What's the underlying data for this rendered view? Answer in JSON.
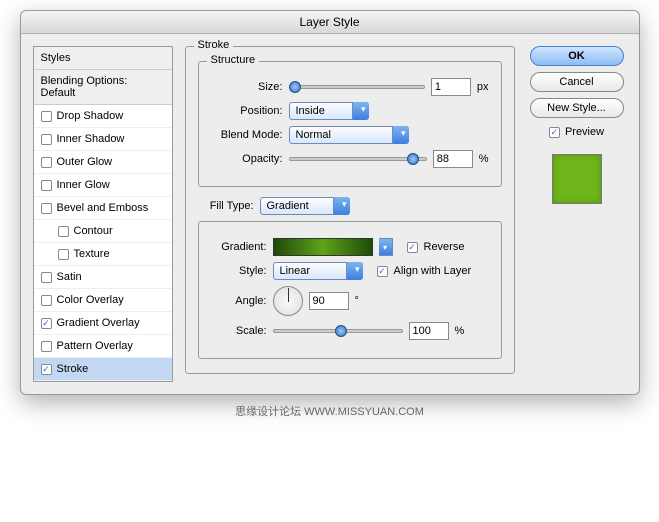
{
  "title": "Layer Style",
  "styles_panel": {
    "header": "Styles",
    "blending_options": "Blending Options: Default",
    "items": [
      {
        "label": "Drop Shadow",
        "checked": false,
        "selected": false,
        "indent": false
      },
      {
        "label": "Inner Shadow",
        "checked": false,
        "selected": false,
        "indent": false
      },
      {
        "label": "Outer Glow",
        "checked": false,
        "selected": false,
        "indent": false
      },
      {
        "label": "Inner Glow",
        "checked": false,
        "selected": false,
        "indent": false
      },
      {
        "label": "Bevel and Emboss",
        "checked": false,
        "selected": false,
        "indent": false
      },
      {
        "label": "Contour",
        "checked": false,
        "selected": false,
        "indent": true
      },
      {
        "label": "Texture",
        "checked": false,
        "selected": false,
        "indent": true
      },
      {
        "label": "Satin",
        "checked": false,
        "selected": false,
        "indent": false
      },
      {
        "label": "Color Overlay",
        "checked": false,
        "selected": false,
        "indent": false
      },
      {
        "label": "Gradient Overlay",
        "checked": true,
        "selected": false,
        "indent": false
      },
      {
        "label": "Pattern Overlay",
        "checked": false,
        "selected": false,
        "indent": false
      },
      {
        "label": "Stroke",
        "checked": true,
        "selected": true,
        "indent": false
      }
    ]
  },
  "stroke": {
    "legend": "Stroke",
    "structure": {
      "legend": "Structure",
      "size_label": "Size:",
      "size_value": "1",
      "size_unit": "px",
      "position_label": "Position:",
      "position_value": "Inside",
      "blendmode_label": "Blend Mode:",
      "blendmode_value": "Normal",
      "opacity_label": "Opacity:",
      "opacity_value": "88",
      "opacity_unit": "%"
    },
    "filltype_label": "Fill Type:",
    "filltype_value": "Gradient",
    "fill": {
      "gradient_label": "Gradient:",
      "reverse_label": "Reverse",
      "reverse_checked": true,
      "style_label": "Style:",
      "style_value": "Linear",
      "align_label": "Align with Layer",
      "align_checked": true,
      "angle_label": "Angle:",
      "angle_value": "90",
      "angle_unit": "°",
      "scale_label": "Scale:",
      "scale_value": "100",
      "scale_unit": "%"
    }
  },
  "buttons": {
    "ok": "OK",
    "cancel": "Cancel",
    "newstyle": "New Style...",
    "preview_label": "Preview",
    "preview_checked": true
  },
  "swatch_color": "#6eb519",
  "footer": "思缘设计论坛  WWW.MISSYUAN.COM"
}
